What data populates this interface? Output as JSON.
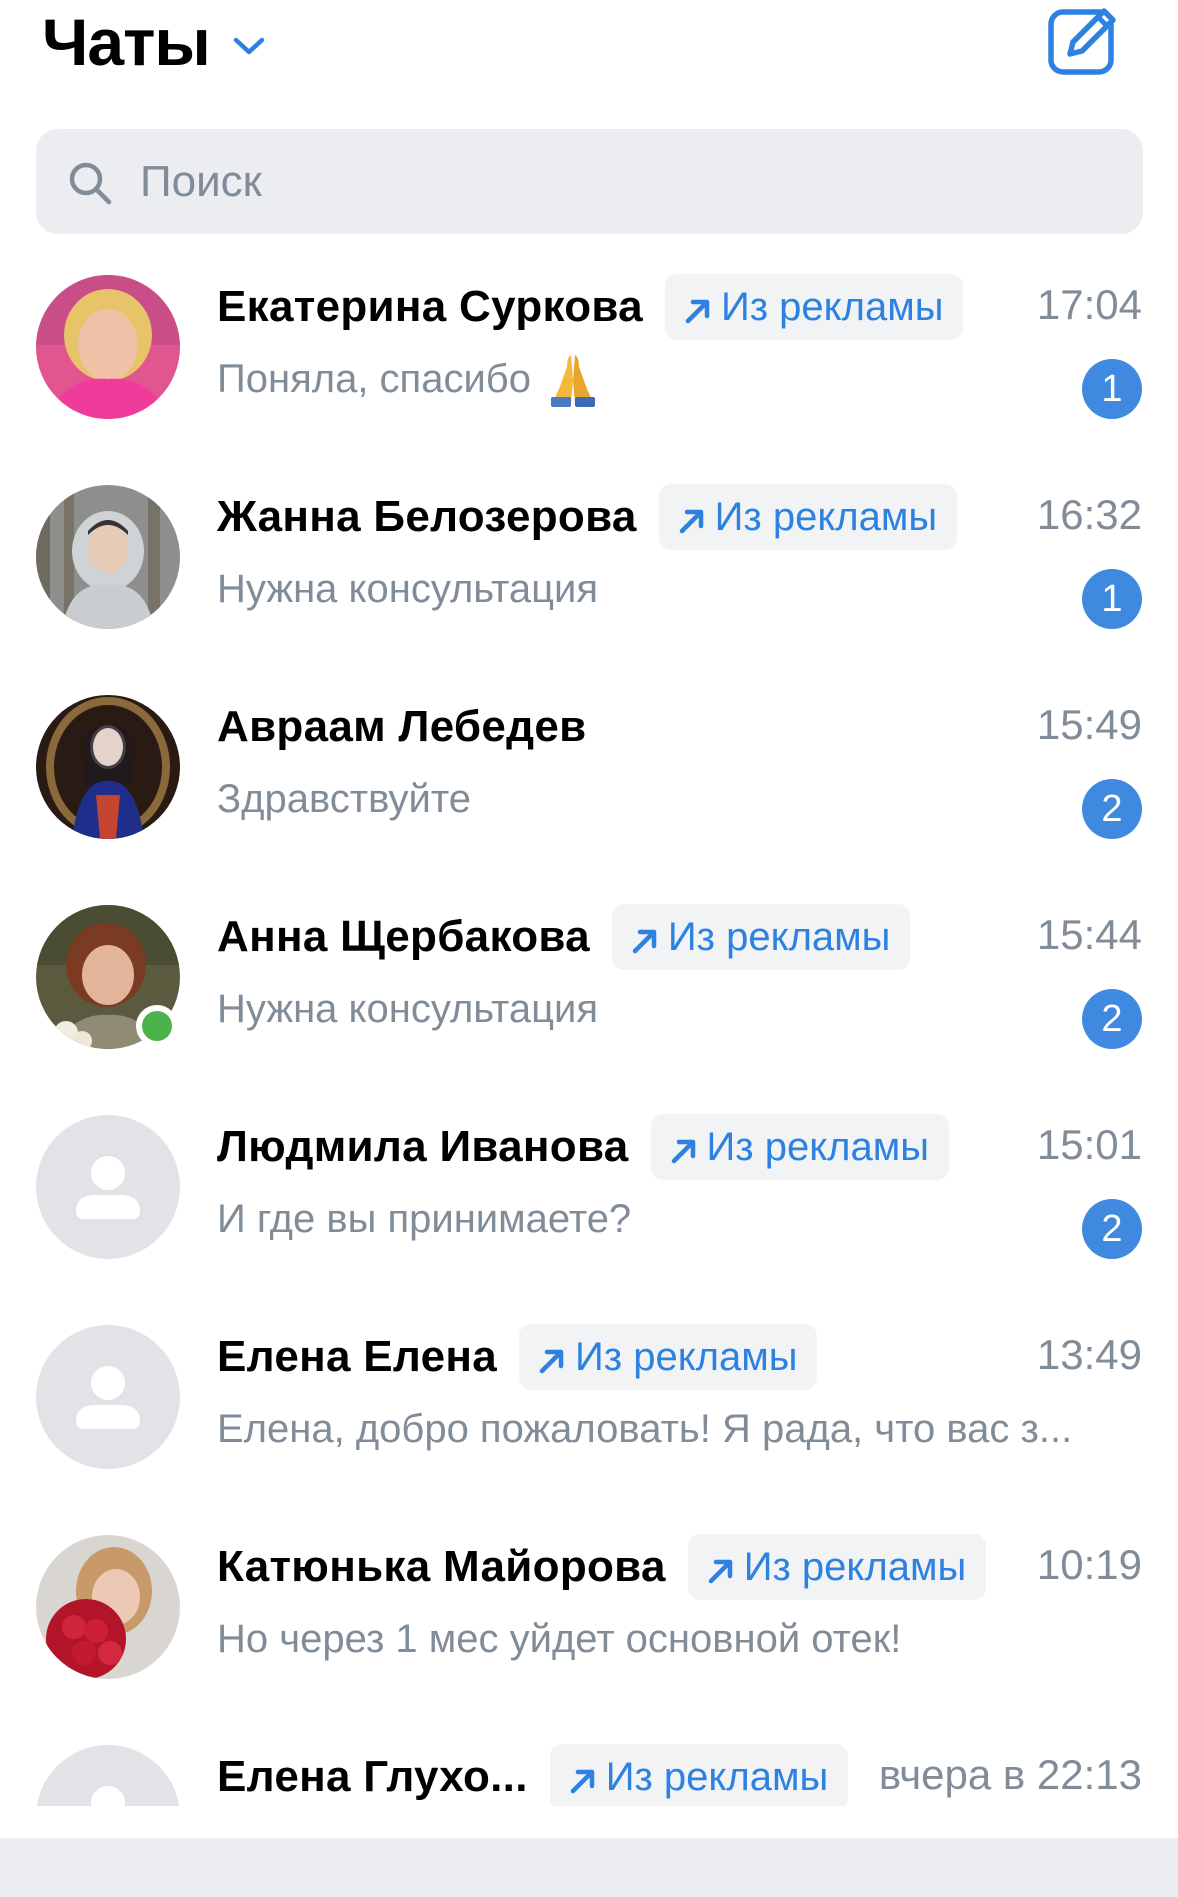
{
  "header": {
    "title": "Чаты",
    "chevron_icon": "chevron-down-icon",
    "compose_icon": "compose-icon"
  },
  "search": {
    "placeholder": "Поиск",
    "icon": "search-icon"
  },
  "colors": {
    "accent": "#2d81e0",
    "badge_bg": "#3f8ae0",
    "muted": "#818c99",
    "online": "#4bb34b"
  },
  "chats": [
    {
      "name": "Екатерина Суркова",
      "ad": "Из рекламы",
      "time": "17:04",
      "preview": "Поняла, спасибо",
      "emoji": "folded-hands",
      "unread": "1",
      "avatar": "photo-woman-pink"
    },
    {
      "name": "Жанна Белозерова",
      "ad": "Из рекламы",
      "time": "16:32",
      "preview": "Нужна консультация",
      "unread": "1",
      "avatar": "photo-woman-winter"
    },
    {
      "name": "Авраам Лебедев",
      "ad": "",
      "time": "15:49",
      "preview": "Здравствуйте",
      "unread": "2",
      "avatar": "photo-painting"
    },
    {
      "name": "Анна Щербакова",
      "ad": "Из рекламы",
      "time": "15:44",
      "preview": "Нужна консультация",
      "unread": "2",
      "avatar": "photo-woman-flowers",
      "online": true
    },
    {
      "name": "Людмила Иванова",
      "ad": "Из рекламы",
      "time": "15:01",
      "preview": "И где вы принимаете?",
      "unread": "2",
      "avatar": "placeholder"
    },
    {
      "name": "Елена Елена",
      "ad": "Из рекламы",
      "time": "13:49",
      "preview": "Елена, добро пожаловать! Я рада, что вас з...",
      "unread": "",
      "avatar": "placeholder"
    },
    {
      "name": "Катюнька Майорова",
      "ad": "Из рекламы",
      "time": "10:19",
      "preview": "Но через 1 мес уйдет основной отек!",
      "unread": "",
      "avatar": "photo-woman-roses"
    },
    {
      "name": "Елена Глухо...",
      "ad": "Из рекламы",
      "time": "вчера в 22:13",
      "preview": "",
      "unread": "",
      "avatar": "placeholder"
    }
  ]
}
